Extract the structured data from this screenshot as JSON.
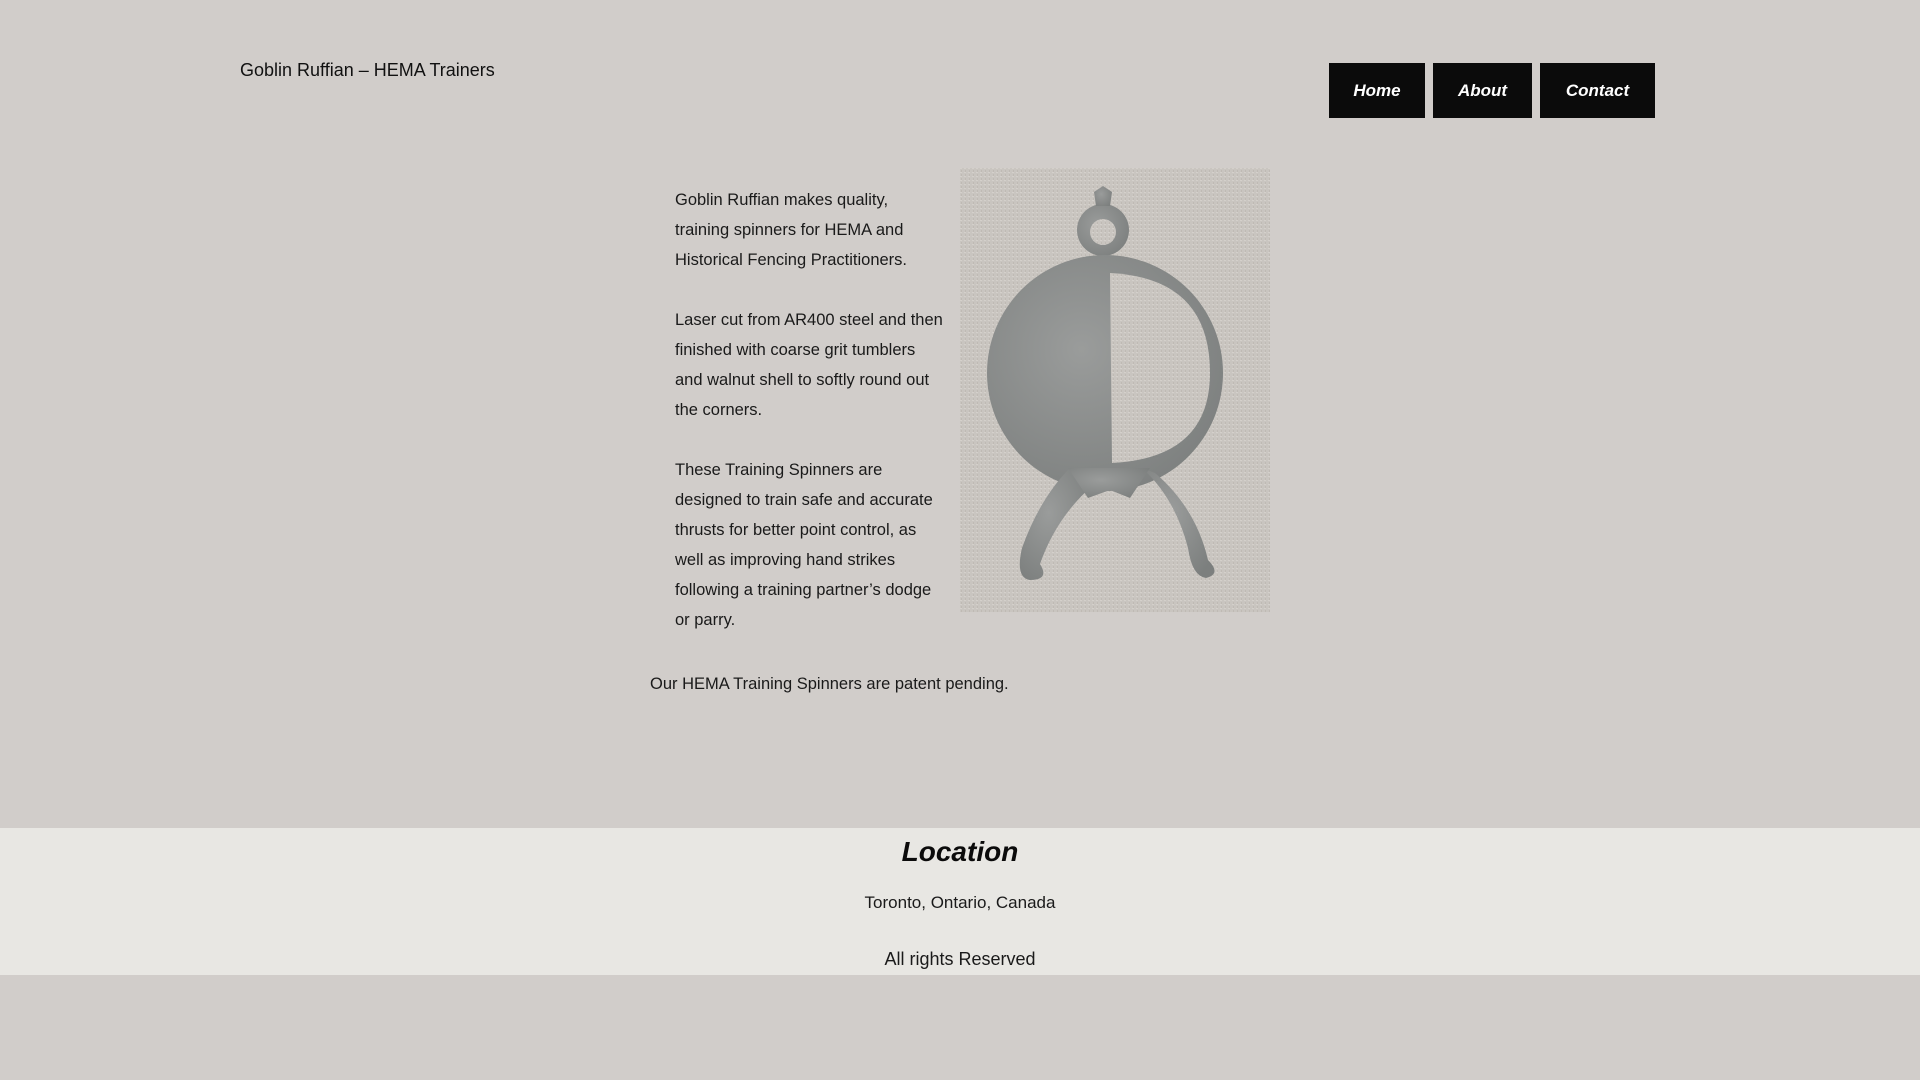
{
  "header": {
    "site_title": "Goblin Ruffian – HEMA Trainers",
    "nav": {
      "home": "Home",
      "about": "About",
      "contact": "Contact"
    }
  },
  "main": {
    "paragraphs": [
      "Goblin Ruffian makes quality, training spinners for HEMA and Historical Fencing Practitioners.",
      "Laser cut from AR400 steel and then finished with coarse grit tumblers and walnut shell to softly round out the corners.",
      "These Training Spinners are designed to train safe and accurate thrusts for better point control, as well as improving hand strikes following a training partner’s dodge or parry."
    ],
    "patent_note": "Our HEMA Training Spinners are patent pending."
  },
  "footer": {
    "heading": "Location",
    "location": "Toronto, Ontario, Canada",
    "rights": "All rights Reserved"
  },
  "colors": {
    "page_background": "#d1cdca",
    "footer_background": "#e8e7e3",
    "nav_button": "#0b0b0b",
    "nav_text": "#ffffff"
  }
}
